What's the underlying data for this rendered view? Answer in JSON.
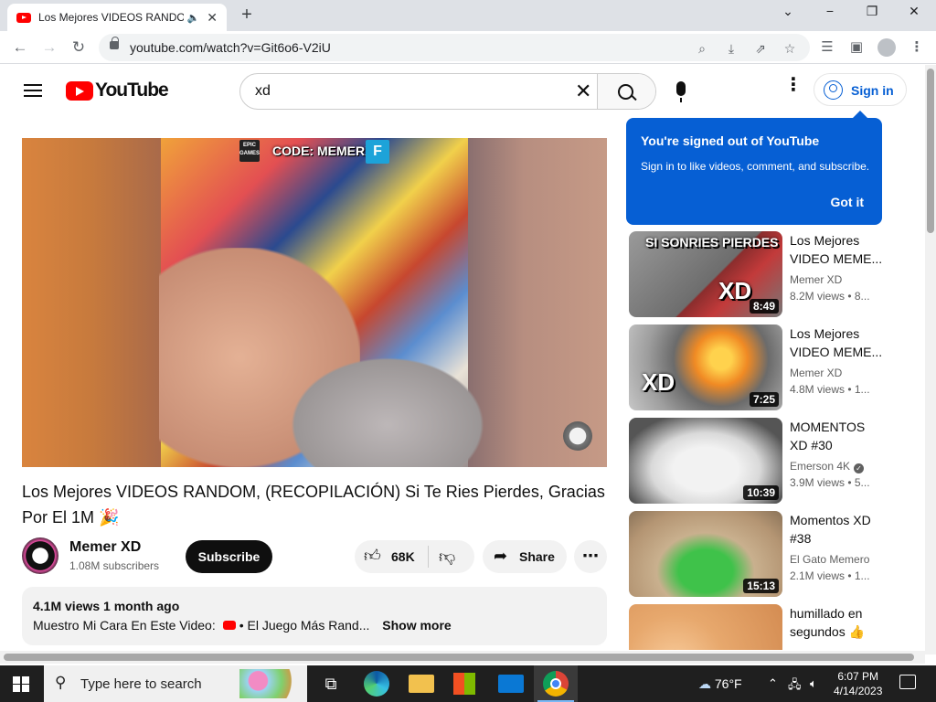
{
  "browser": {
    "tab_title": "Los Mejores VIDEOS RANDO",
    "url": "youtube.com/watch?v=Git6o6-V2iU",
    "new_tab": "+",
    "win_min": "−",
    "win_max": "❐",
    "win_close": "✕",
    "tab_close": "✕",
    "speaker": "🔈"
  },
  "yt": {
    "logo_text": "YouTube",
    "search_value": "xd",
    "signin_label": "Sign in"
  },
  "tooltip": {
    "heading": "You're signed out of YouTube",
    "body": "Sign in to like videos, comment, and subscribe.",
    "button": "Got it"
  },
  "player": {
    "overlay_code": "CODE: MEMERXD",
    "epic_label": "EPIC GAMES",
    "f_badge": "F"
  },
  "video": {
    "title": "Los Mejores VIDEOS RANDOM, (RECOPILACIÓN) Si Te Ries Pierdes, Gracias Por El 1M 🎉",
    "channel": "Memer XD",
    "subscribers": "1.08M subscribers",
    "subscribe_label": "Subscribe",
    "likes": "68K",
    "share_label": "Share",
    "more_label": "⋯",
    "views_date": "4.1M views  1 month ago",
    "desc_prefix": "Muestro Mi Cara En Este Video:",
    "desc_link": "• El Juego Más Rand...",
    "show_more": "Show more"
  },
  "recommendations": [
    {
      "title": "Los Mejores VIDEO MEME...",
      "channel": "Memer XD",
      "meta": "8.2M views  • 8...",
      "duration": "8:49",
      "overlay": "SI SONRIES PIERDES",
      "overlay2": "XD",
      "verified": false
    },
    {
      "title": "Los Mejores VIDEO MEME...",
      "channel": "Memer XD",
      "meta": "4.8M views  • 1...",
      "duration": "7:25",
      "overlay": "XD",
      "verified": false
    },
    {
      "title": "MOMENTOS XD #30",
      "channel": "Emerson 4K",
      "meta": "3.9M views  • 5...",
      "duration": "10:39",
      "verified": true
    },
    {
      "title": "Momentos XD #38",
      "channel": "El Gato Memero",
      "meta": "2.1M views  • 1...",
      "duration": "15:13",
      "verified": false
    },
    {
      "title": "humillado en segundos 👍",
      "channel": "",
      "meta": "",
      "duration": "",
      "verified": false
    }
  ],
  "taskbar": {
    "search_placeholder": "Type here to search",
    "temperature": "76°F",
    "time": "6:07 PM",
    "date": "4/14/2023"
  },
  "colors": {
    "yt_red": "#ff0000",
    "signin_blue": "#065fd4",
    "tooltip_bg": "#065fd4",
    "subscribe_bg": "#0f0f0f"
  }
}
